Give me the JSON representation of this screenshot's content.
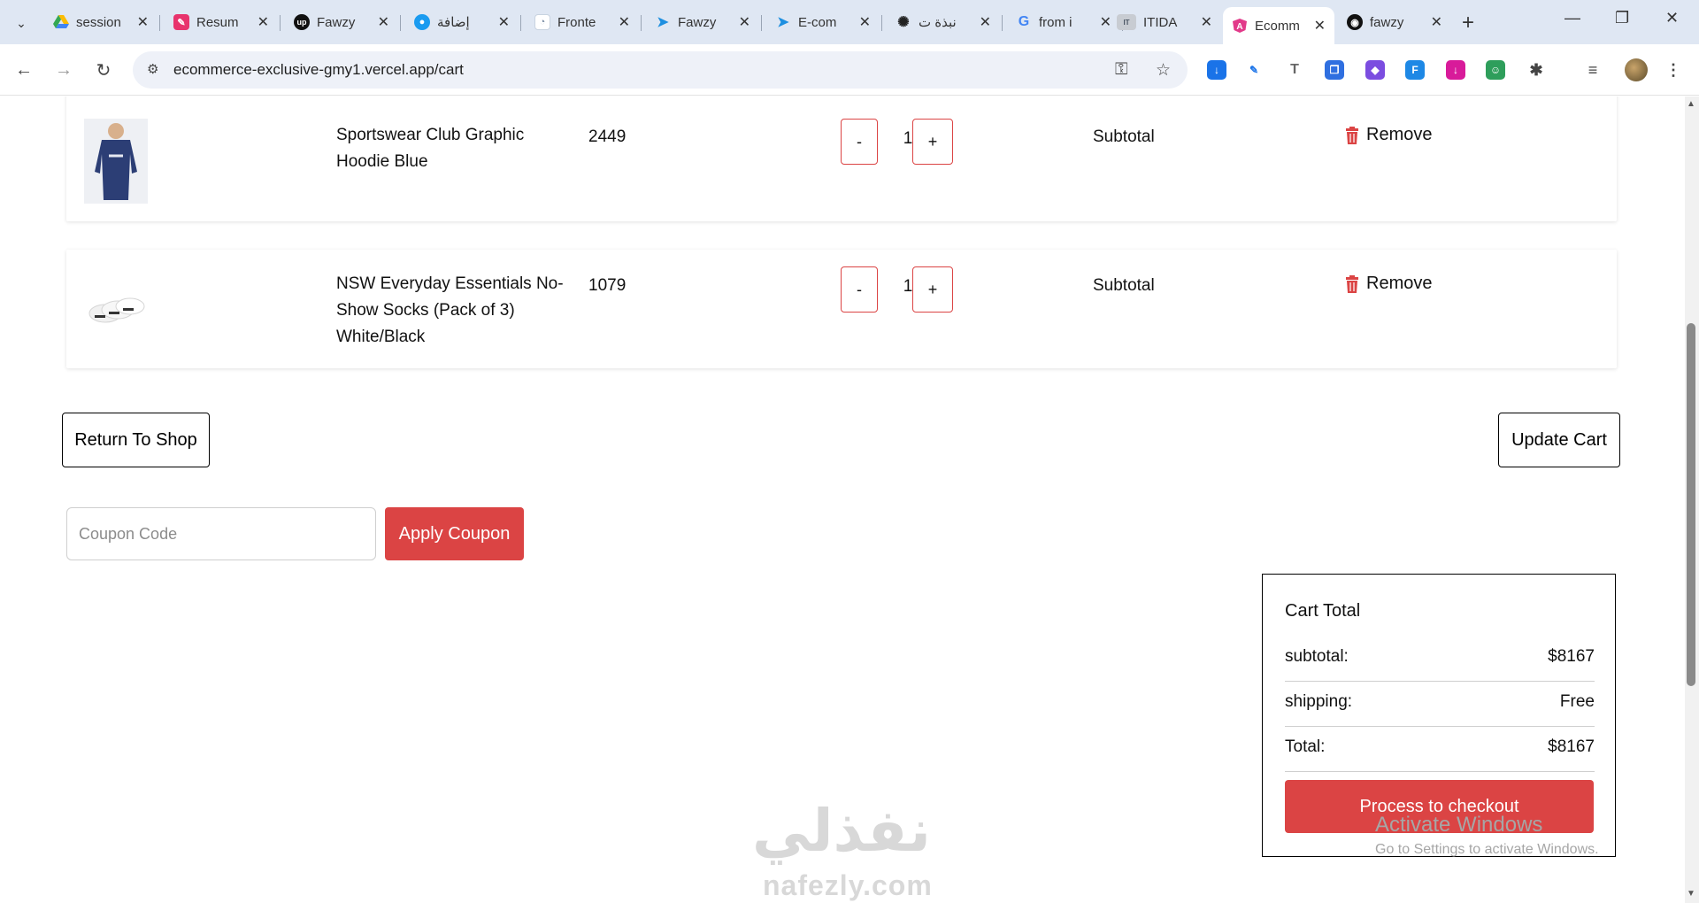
{
  "browser": {
    "tabs": [
      {
        "title": "session",
        "favicon": "google-drive",
        "color": "#1a73e8"
      },
      {
        "title": "Resum",
        "favicon": "resume-app",
        "color": "#e8336d"
      },
      {
        "title": "Fawzy",
        "favicon": "upwork",
        "color": "#111111"
      },
      {
        "title": "إضافة",
        "favicon": "circle-app",
        "color": "#1a9bf0"
      },
      {
        "title": "Fronte",
        "favicon": "doc-page",
        "color": "#9ab0c8"
      },
      {
        "title": "Fawzy",
        "favicon": "kite-app",
        "color": "#1d8fe0"
      },
      {
        "title": "E-com",
        "favicon": "kite-app",
        "color": "#1d8fe0"
      },
      {
        "title": "نبذة ت",
        "favicon": "openai",
        "color": "#222222"
      },
      {
        "title": "from i",
        "favicon": "google",
        "color": "#4285f4"
      },
      {
        "title": "ITIDA",
        "favicon": "itida",
        "color": "#6b7a8c"
      },
      {
        "title": "Ecomm",
        "favicon": "angular",
        "color": "#dd0031",
        "active": true
      },
      {
        "title": "fawzy",
        "favicon": "github",
        "color": "#111111"
      }
    ],
    "new_tab": "+",
    "url": "ecommerce-exclusive-gmy1.vercel.app/cart"
  },
  "cart": {
    "items": [
      {
        "name": "Sportswear Club Graphic Hoodie Blue",
        "price": "2449",
        "qty": "1",
        "subtotal_label": "Subtotal",
        "remove_label": "Remove",
        "image": "hoodie-image"
      },
      {
        "name": "NSW Everyday Essentials No-Show Socks (Pack of 3) White/Black",
        "price": "1079",
        "qty": "1",
        "subtotal_label": "Subtotal",
        "remove_label": "Remove",
        "image": "socks-image"
      }
    ],
    "minus": "-",
    "plus": "+",
    "return_label": "Return To Shop",
    "update_label": "Update Cart",
    "coupon_placeholder": "Coupon Code",
    "apply_label": "Apply Coupon"
  },
  "cart_total": {
    "title": "Cart Total",
    "rows": [
      {
        "label": "subtotal:",
        "value": "$8167"
      },
      {
        "label": "shipping:",
        "value": "Free"
      },
      {
        "label": "Total:",
        "value": "$8167"
      }
    ],
    "checkout_label": "Process to checkout"
  },
  "overlay": {
    "watermark_ar": "نفذلي",
    "watermark_en": "nafezly.com",
    "activate_title": "Activate Windows",
    "activate_sub": "Go to Settings to activate Windows."
  },
  "colors": {
    "accent": "#db4444",
    "tabbar": "#dfe7f3"
  }
}
